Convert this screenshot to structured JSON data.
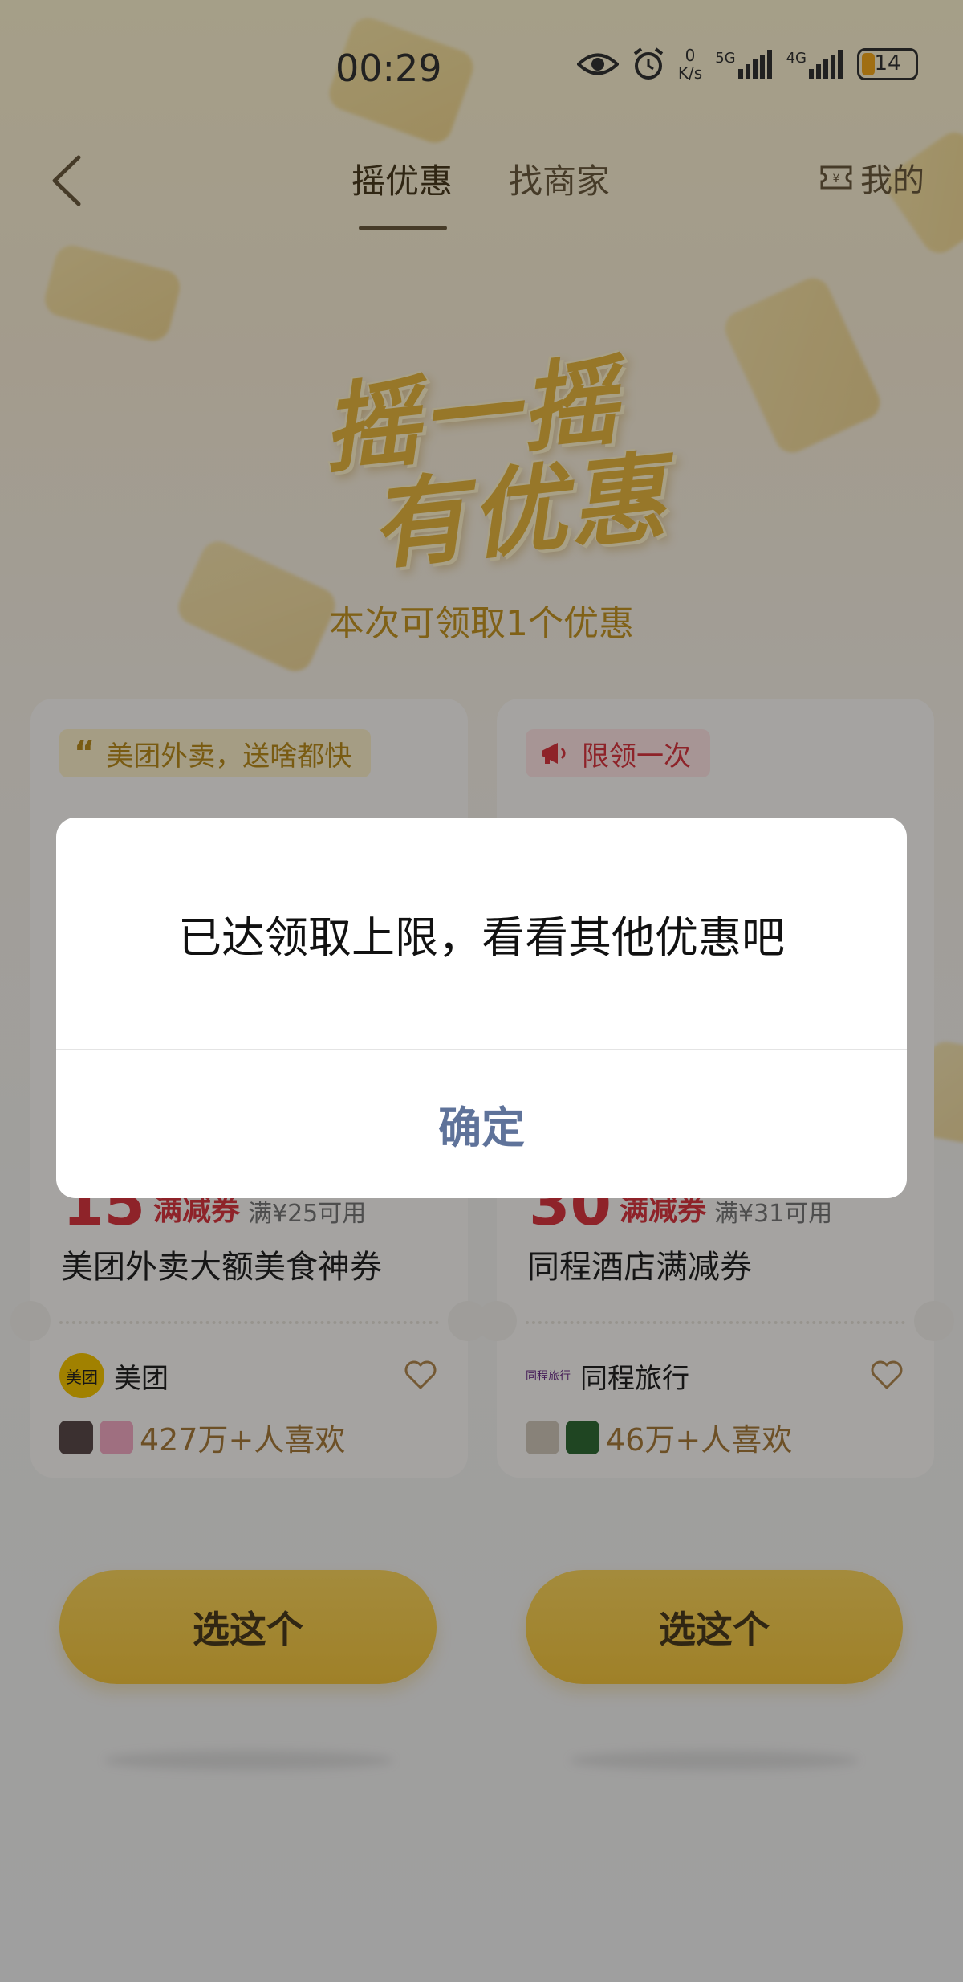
{
  "status_bar": {
    "time": "00:29",
    "net_speed_value": "0",
    "net_speed_unit": "K/s",
    "signal_1": "5G",
    "signal_2": "4G",
    "battery": "14"
  },
  "header": {
    "tabs": [
      {
        "label": "摇优惠",
        "active": true
      },
      {
        "label": "找商家",
        "active": false
      }
    ],
    "mine_label": "我的"
  },
  "hero": {
    "line1": "摇一摇",
    "line2": "有优惠",
    "subtitle": "本次可领取1个优惠"
  },
  "cards": [
    {
      "tag": "美团外卖，送啥都快",
      "price": "15",
      "kind": "满减券",
      "condition": "满¥25可用",
      "title": "美团外卖大额美食神券",
      "brand_logo_text": "美团",
      "brand": "美团",
      "likes": "427万+人喜欢",
      "cta": "选这个"
    },
    {
      "tag": "限领一次",
      "price": "30",
      "kind": "满减券",
      "condition": "满¥31可用",
      "title": "同程酒店满减券",
      "brand_logo_text": "同程旅行",
      "brand": "同程旅行",
      "likes": "46万+人喜欢",
      "cta": "选这个"
    }
  ],
  "dialog": {
    "message": "已达领取上限，看看其他优惠吧",
    "confirm": "确定"
  },
  "colors": {
    "accent_gold": "#f2c33d",
    "price_red": "#d8363f",
    "dialog_button": "#5f739a"
  }
}
